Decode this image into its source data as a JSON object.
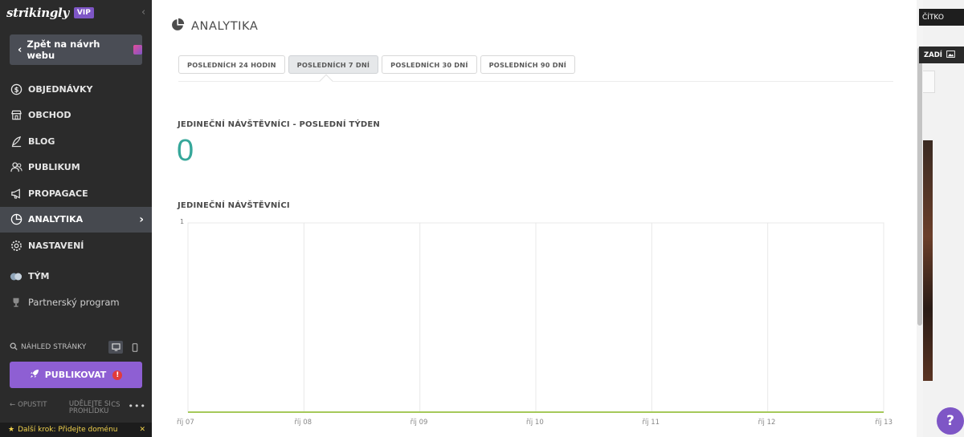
{
  "sidebar": {
    "logo": "strikingly",
    "vip": "VIP",
    "back_label": "Zpět na návrh webu",
    "items": [
      {
        "label": "OBJEDNÁVKY",
        "icon": "dollar-circle-icon"
      },
      {
        "label": "OBCHOD",
        "icon": "store-icon"
      },
      {
        "label": "BLOG",
        "icon": "pen-icon"
      },
      {
        "label": "PUBLIKUM",
        "icon": "users-icon"
      },
      {
        "label": "PROPAGACE",
        "icon": "megaphone-icon"
      },
      {
        "label": "ANALYTIKA",
        "icon": "pie-chart-icon"
      },
      {
        "label": "NASTAVENÍ",
        "icon": "gear-icon"
      },
      {
        "label": "TÝM",
        "icon": "team-avatars-icon"
      },
      {
        "label": "Partnerský program",
        "icon": "trophy-icon"
      }
    ],
    "preview_label": "NÁHLED STRÁNKY",
    "publish_label": "PUBLIKOVAT",
    "exit_label": "OPUSTIT",
    "feedback_label": "UDĚLEJTE SI PROHLÍDKU",
    "lang_label": "CS",
    "next_step": "Další krok: Přidejte doménu"
  },
  "main": {
    "title": "ANALYTIKA",
    "tabs": [
      {
        "label": "POSLEDNÍCH 24 HODIN"
      },
      {
        "label": "POSLEDNÍCH 7 DNÍ"
      },
      {
        "label": "POSLEDNÍCH 30 DNÍ"
      },
      {
        "label": "POSLEDNÍCH 90 DNÍ"
      }
    ],
    "unique_week_label": "JEDINEČNÍ NÁVŠTĚVNÍCI - POSLEDNÍ TÝDEN",
    "unique_week_value": "0",
    "chart_label": "JEDINEČNÍ NÁVŠTĚVNÍCI"
  },
  "chart_data": {
    "type": "line",
    "x": [
      "říj 07",
      "říj 08",
      "říj 09",
      "říj 10",
      "říj 11",
      "říj 12",
      "říj 13"
    ],
    "series": [
      {
        "values": [
          0,
          0,
          0,
          0,
          0,
          0,
          0
        ]
      }
    ],
    "ylim": [
      0,
      1
    ],
    "yticks": [
      "1"
    ],
    "grid": true,
    "line_color": "#a5c95a"
  },
  "right": {
    "btn1": "ČÍTKO",
    "btn2": "ZADÍ"
  },
  "help_label": "?"
}
